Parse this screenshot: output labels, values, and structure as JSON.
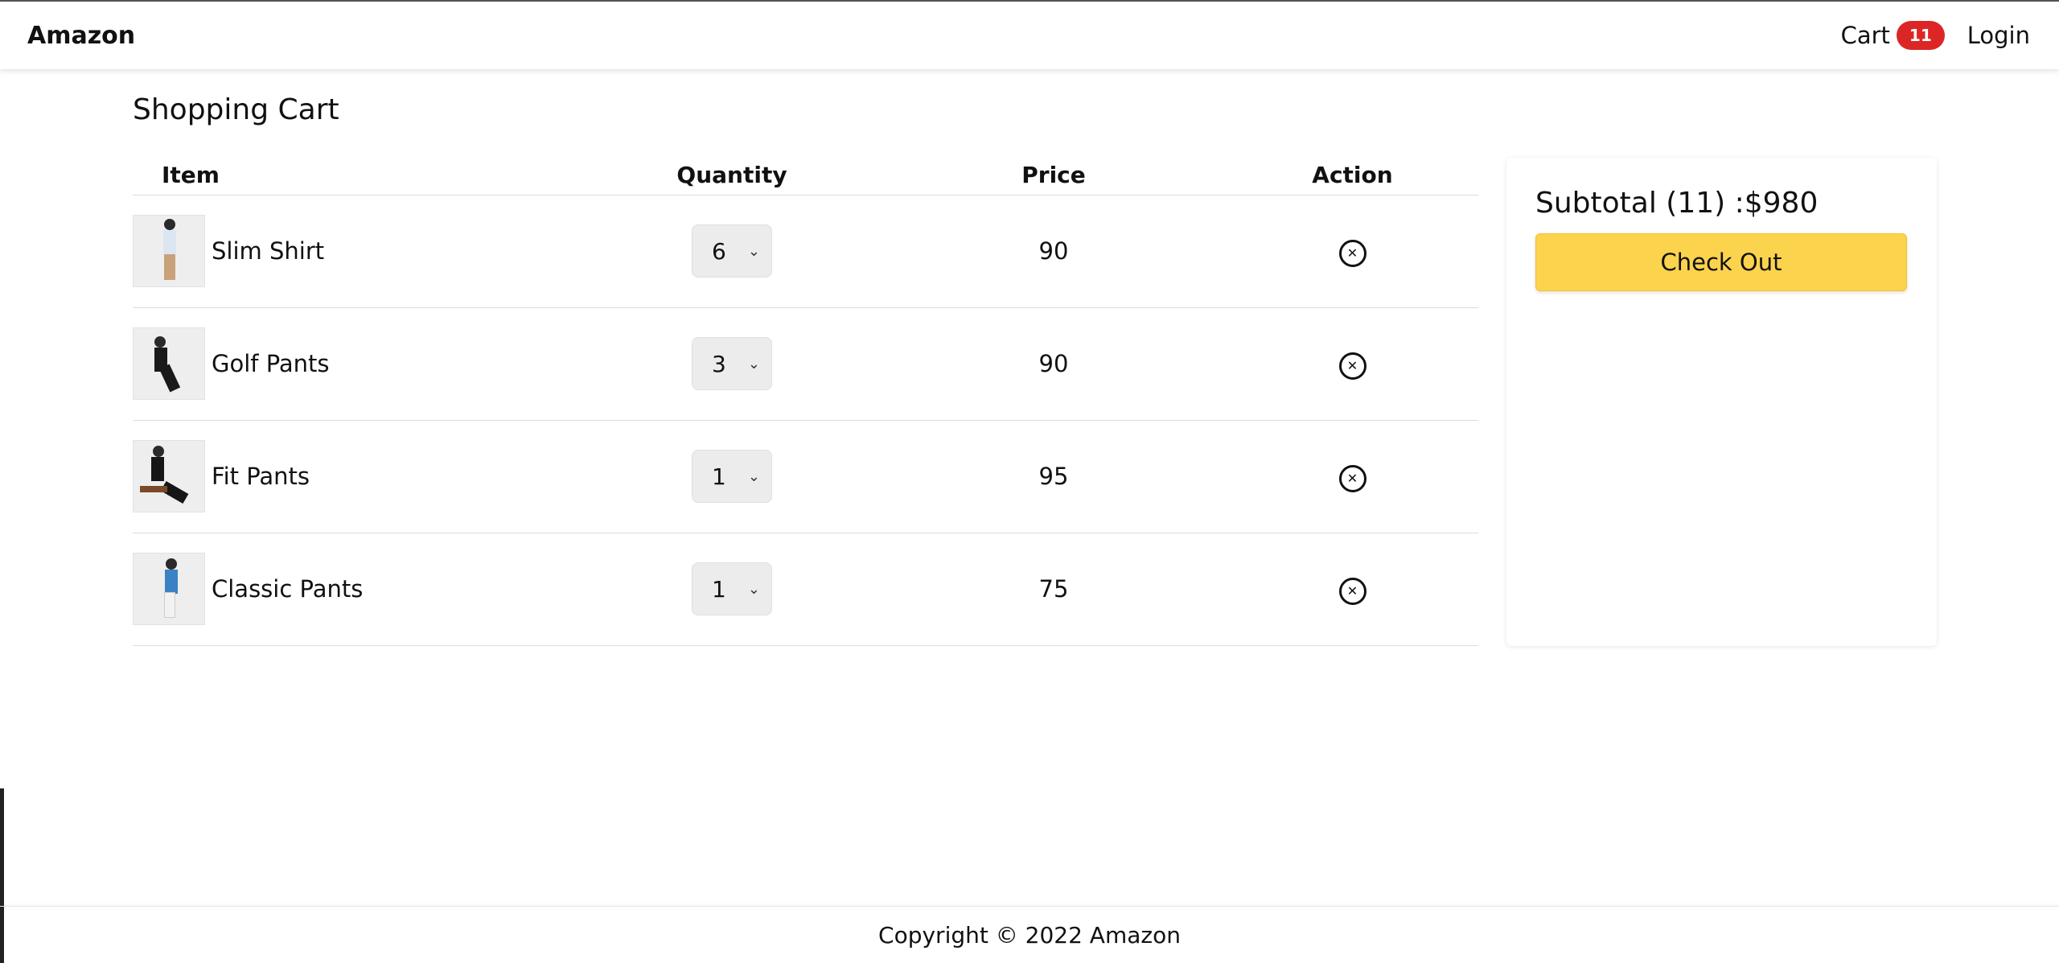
{
  "navbar": {
    "brand": "Amazon",
    "cart_label": "Cart",
    "cart_count": "11",
    "login_label": "Login"
  },
  "page": {
    "title": "Shopping Cart"
  },
  "table": {
    "headers": {
      "item": "Item",
      "quantity": "Quantity",
      "price": "Price",
      "action": "Action"
    },
    "rows": [
      {
        "name": "Slim Shirt",
        "quantity": "6",
        "price": "90"
      },
      {
        "name": "Golf Pants",
        "quantity": "3",
        "price": "90"
      },
      {
        "name": "Fit Pants",
        "quantity": "1",
        "price": "95"
      },
      {
        "name": "Classic Pants",
        "quantity": "1",
        "price": "75"
      }
    ]
  },
  "summary": {
    "subtotal_text": "Subtotal (11) :$980",
    "checkout_label": "Check Out"
  },
  "footer": {
    "text": "Copyright © 2022 Amazon"
  },
  "colors": {
    "checkout": "#fcd34d",
    "badge": "#dc2626"
  }
}
